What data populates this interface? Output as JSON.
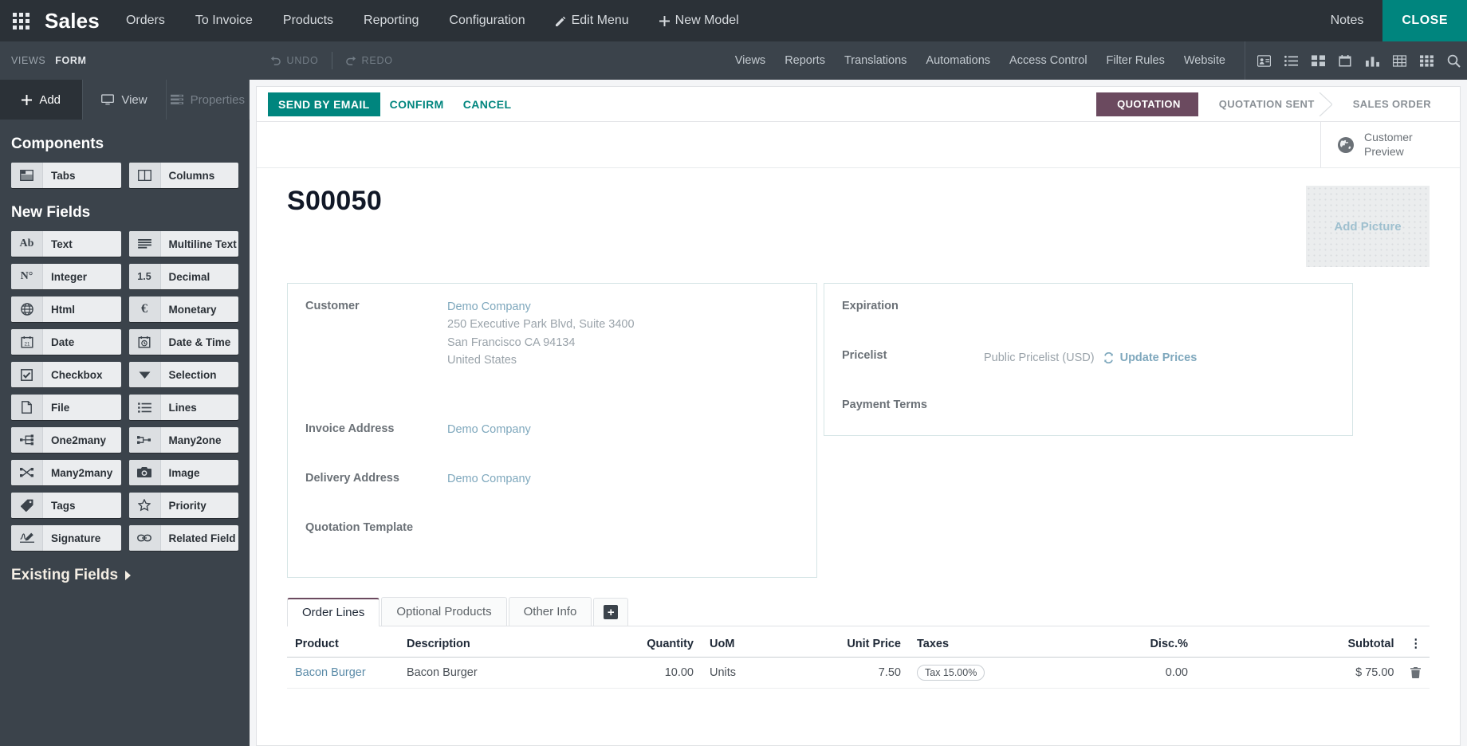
{
  "navbar": {
    "apps_icon": "apps-grid-icon",
    "brand": "Sales",
    "menus": [
      {
        "label": "Orders",
        "icon": null
      },
      {
        "label": "To Invoice",
        "icon": null
      },
      {
        "label": "Products",
        "icon": null
      },
      {
        "label": "Reporting",
        "icon": null
      },
      {
        "label": "Configuration",
        "icon": null
      },
      {
        "label": "Edit Menu",
        "icon": "pencil-icon"
      },
      {
        "label": "New Model",
        "icon": "plus-icon"
      }
    ],
    "notes": "Notes",
    "close": "CLOSE",
    "close_bg": "#00857e"
  },
  "subbar": {
    "views_label": "VIEWS",
    "form_label": "FORM",
    "undo": "UNDO",
    "redo": "REDO",
    "links": [
      "Views",
      "Reports",
      "Translations",
      "Automations",
      "Access Control",
      "Filter Rules",
      "Website"
    ],
    "icons": [
      "contact-card-icon",
      "list-icon",
      "kanban-icon",
      "calendar-icon",
      "graph-icon",
      "pivot-icon",
      "grid-icon",
      "search-icon"
    ]
  },
  "sidebar": {
    "tabs": [
      {
        "label": "Add",
        "icon": "plus-icon",
        "active": true
      },
      {
        "label": "View",
        "icon": "monitor-icon",
        "active": false
      },
      {
        "label": "Properties",
        "icon": "properties-icon",
        "active": false
      }
    ],
    "components_heading": "Components",
    "components": [
      {
        "label": "Tabs",
        "icon": "tabs-icon"
      },
      {
        "label": "Columns",
        "icon": "columns-icon"
      }
    ],
    "new_fields_heading": "New Fields",
    "new_fields": [
      {
        "label": "Text",
        "icon": "ab-icon"
      },
      {
        "label": "Multiline Text",
        "icon": "multiline-text-icon"
      },
      {
        "label": "Integer",
        "icon": "number-icon"
      },
      {
        "label": "Decimal",
        "icon": "decimal-icon"
      },
      {
        "label": "Html",
        "icon": "globe-icon"
      },
      {
        "label": "Monetary",
        "icon": "euro-icon"
      },
      {
        "label": "Date",
        "icon": "calendar-icon"
      },
      {
        "label": "Date & Time",
        "icon": "calendar-clock-icon"
      },
      {
        "label": "Checkbox",
        "icon": "checkbox-icon"
      },
      {
        "label": "Selection",
        "icon": "caret-down-icon"
      },
      {
        "label": "File",
        "icon": "file-icon"
      },
      {
        "label": "Lines",
        "icon": "lines-icon"
      },
      {
        "label": "One2many",
        "icon": "one2many-icon"
      },
      {
        "label": "Many2one",
        "icon": "many2one-icon"
      },
      {
        "label": "Many2many",
        "icon": "many2many-icon"
      },
      {
        "label": "Image",
        "icon": "camera-icon"
      },
      {
        "label": "Tags",
        "icon": "tag-icon"
      },
      {
        "label": "Priority",
        "icon": "star-icon"
      },
      {
        "label": "Signature",
        "icon": "signature-icon"
      },
      {
        "label": "Related Field",
        "icon": "link-icon"
      }
    ],
    "existing_fields": "Existing Fields",
    "existing_fields_caret": "caret-right-icon"
  },
  "control_panel": {
    "buttons": [
      {
        "label": "SEND BY EMAIL",
        "primary": true
      },
      {
        "label": "CONFIRM",
        "primary": false
      },
      {
        "label": "CANCEL",
        "primary": false
      }
    ],
    "statusbar": [
      {
        "label": "QUOTATION",
        "active": true
      },
      {
        "label": "QUOTATION SENT",
        "active": false
      },
      {
        "label": "SALES ORDER",
        "active": false
      }
    ],
    "active_status_color": "#6b4a5f"
  },
  "form": {
    "customer_preview": {
      "line1": "Customer",
      "line2": "Preview",
      "icon": "globe-icon"
    },
    "record_title": "S00050",
    "add_picture": "Add Picture",
    "left_group": {
      "customer": {
        "label": "Customer",
        "name": "Demo Company",
        "address": [
          "250 Executive Park Blvd, Suite 3400",
          "San Francisco CA 94134",
          "United States"
        ]
      },
      "invoice_address": {
        "label": "Invoice Address",
        "value": "Demo Company"
      },
      "delivery_address": {
        "label": "Delivery Address",
        "value": "Demo Company"
      },
      "quotation_template": {
        "label": "Quotation Template",
        "value": ""
      }
    },
    "right_group": {
      "expiration": {
        "label": "Expiration",
        "value": ""
      },
      "pricelist": {
        "label": "Pricelist",
        "value": "Public Pricelist (USD)",
        "update_label": "Update Prices",
        "update_icon": "refresh-icon"
      },
      "payment_terms": {
        "label": "Payment Terms",
        "value": ""
      }
    }
  },
  "notebook": {
    "tabs": [
      {
        "label": "Order Lines",
        "active": true
      },
      {
        "label": "Optional Products",
        "active": false
      },
      {
        "label": "Other Info",
        "active": false
      }
    ],
    "add_tab_icon": "plus-box-icon",
    "table": {
      "columns": [
        "Product",
        "Description",
        "Quantity",
        "UoM",
        "Unit Price",
        "Taxes",
        "Disc.%",
        "Subtotal"
      ],
      "options_icon": "vertical-dots-icon",
      "rows": [
        {
          "product": "Bacon Burger",
          "description": "Bacon Burger",
          "quantity": "10.00",
          "uom": "Units",
          "unit_price": "7.50",
          "taxes": "Tax 15.00%",
          "disc": "0.00",
          "subtotal": "$ 75.00",
          "delete_icon": "trash-icon"
        }
      ]
    }
  }
}
